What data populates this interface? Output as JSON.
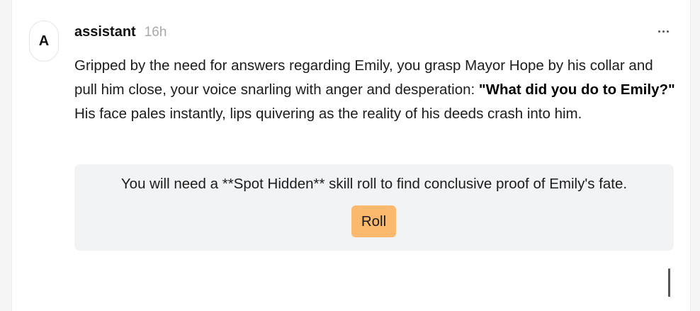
{
  "message": {
    "avatar_letter": "A",
    "author": "assistant",
    "time": "16h",
    "text_before_bold": "Gripped by the need for answers regarding Emily, you grasp Mayor Hope by his collar and pull him close, your voice snarling with anger and desperation: ",
    "bold_text": "\"What did you do to Emily?\"",
    "text_after_bold": " His face pales instantly, lips quivering as the reality of his deeds crash into him.",
    "menu_icon": "more-horizontal-icon"
  },
  "skill_check": {
    "prompt": "You will need a **Spot Hidden** skill roll to find conclusive proof of Emily's fate.",
    "button_label": "Roll"
  },
  "colors": {
    "roll_button": "#fbb96e",
    "box_background": "#f2f3f5",
    "time_text": "#a8a8a8"
  }
}
